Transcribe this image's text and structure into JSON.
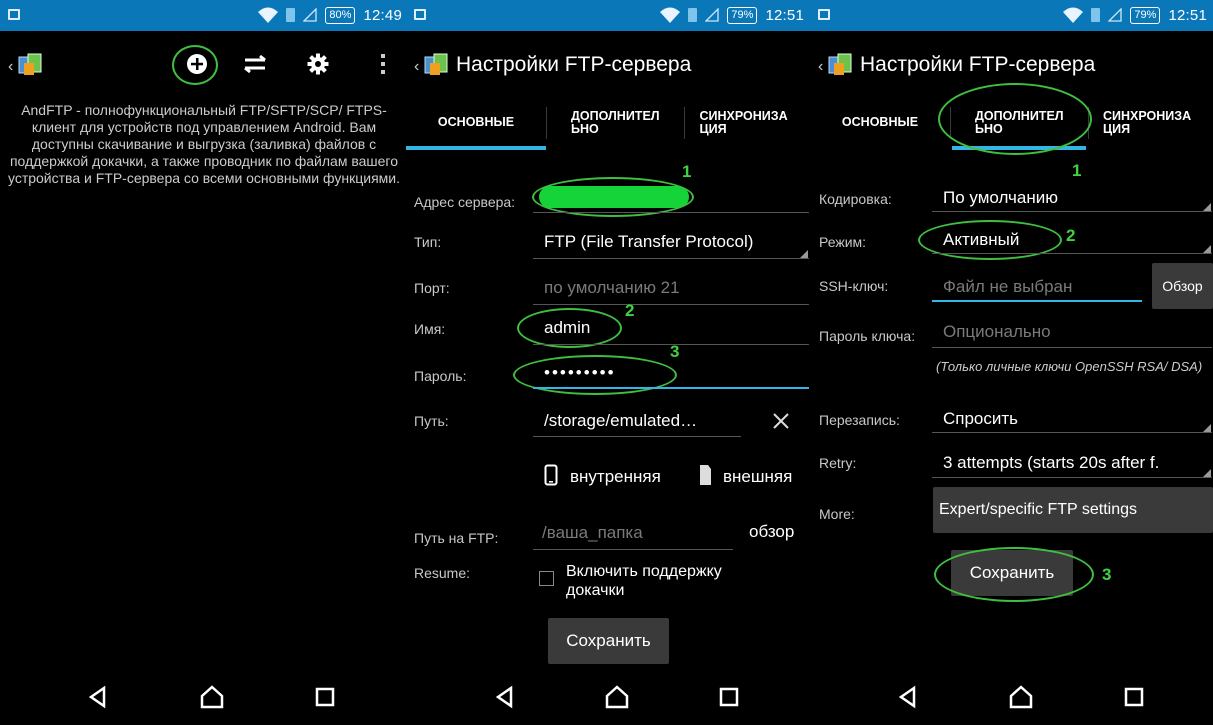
{
  "colors": {
    "statusbar": "#0a78b8",
    "accent": "#33b5e5",
    "annotation": "#3fbf3f",
    "button_bg": "#3a3a3a"
  },
  "icons": [
    "gallery-icon",
    "wifi-icon",
    "sim-icon",
    "signal-icon",
    "battery-icon",
    "app-icon",
    "add-icon",
    "transfer-icon",
    "settings-icon",
    "overflow-icon",
    "close-icon",
    "phone-icon",
    "sdcard-icon",
    "back-nav-icon",
    "home-nav-icon",
    "recents-nav-icon"
  ],
  "panel1": {
    "status": {
      "battery": "80%",
      "time": "12:49"
    },
    "description": "AndFTP - полнофункциональный FTP/SFTP/SCP/ FTPS-клиент для устройств под управлением Android. Вам доступны скачивание и выгрузка (заливка) файлов с поддержкой докачки, а также проводник по файлам вашего устройства и FTP-сервера со всеми основными функциями."
  },
  "panel2": {
    "status": {
      "battery": "79%",
      "time": "12:51"
    },
    "title": "Настройки FTP-сервера",
    "tabs": [
      {
        "label": "ОСНОВНЫЕ"
      },
      {
        "label": "ДОПОЛНИТЕЛ ЬНО"
      },
      {
        "label": "СИНХРОНИЗА ЦИЯ"
      }
    ],
    "fields": {
      "server_label": "Адрес сервера:",
      "type_label": "Тип:",
      "type_value": "FTP (File Transfer Protocol)",
      "port_label": "Порт:",
      "port_placeholder": "по умолчанию 21",
      "name_label": "Имя:",
      "name_value": "admin",
      "password_label": "Пароль:",
      "password_value": "•••••••••",
      "path_label": "Путь:",
      "path_value": "/storage/emulated…",
      "internal_label": "внутренняя",
      "external_label": "внешняя",
      "ftp_path_label": "Путь на FTP:",
      "ftp_path_placeholder": "/ваша_папка",
      "browse_label": "обзор",
      "resume_label": "Resume:",
      "resume_checkbox": "Включить поддержку докачки",
      "save_label": "Сохранить"
    },
    "annotations": [
      "1",
      "2",
      "3"
    ]
  },
  "panel3": {
    "status": {
      "battery": "79%",
      "time": "12:51"
    },
    "title": "Настройки FTP-сервера",
    "tabs": [
      {
        "label": "ОСНОВНЫЕ"
      },
      {
        "label": "ДОПОЛНИТЕЛ ЬНО"
      },
      {
        "label": "СИНХРОНИЗА ЦИЯ"
      }
    ],
    "fields": {
      "encoding_label": "Кодировка:",
      "encoding_value": "По умолчанию",
      "mode_label": "Режим:",
      "mode_value": "Активный",
      "ssh_label": "SSH-ключ:",
      "ssh_placeholder": "Файл не выбран",
      "ssh_browse": "Обзор",
      "keypass_label": "Пароль ключа:",
      "keypass_placeholder": "Опционально",
      "keypass_note": "(Только личные ключи OpenSSH RSA/ DSA)",
      "overwrite_label": "Перезапись:",
      "overwrite_value": "Спросить",
      "retry_label": "Retry:",
      "retry_value": "3 attempts (starts 20s after f.",
      "more_label": "More:",
      "more_button": "Expert/specific FTP settings",
      "save_label": "Сохранить"
    },
    "annotations": [
      "1",
      "2",
      "3"
    ]
  }
}
